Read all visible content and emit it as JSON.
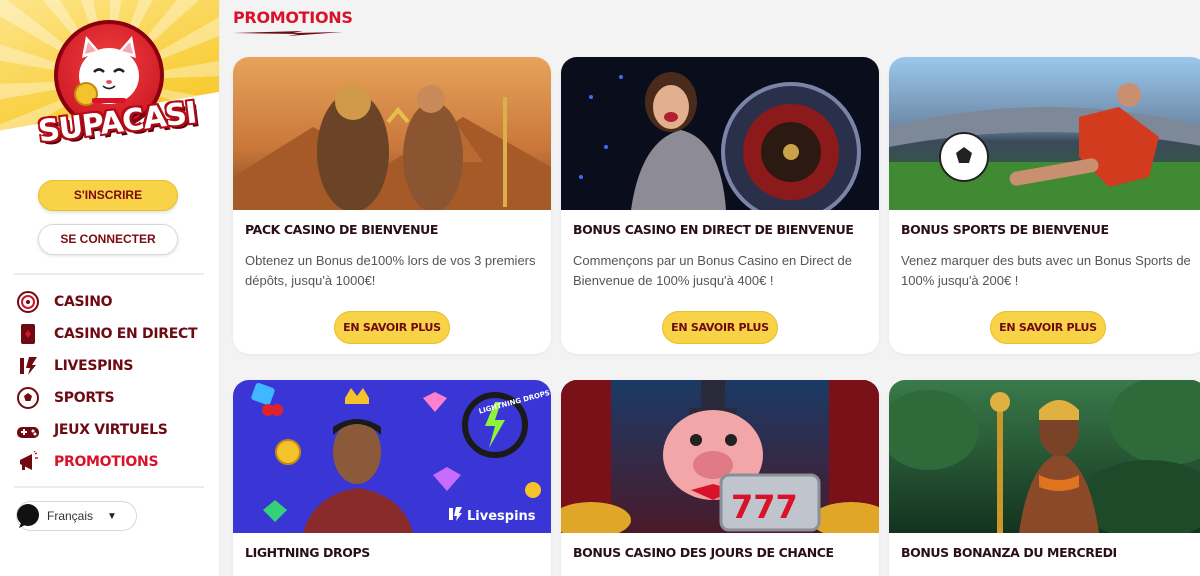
{
  "brand": {
    "name": "SUPACASI"
  },
  "sidebar": {
    "signup_label": "S'INSCRIRE",
    "login_label": "SE CONNECTER",
    "items": [
      {
        "label": "CASINO",
        "icon": "roulette-icon",
        "active": false
      },
      {
        "label": "CASINO EN DIRECT",
        "icon": "card-icon",
        "active": false
      },
      {
        "label": "LIVESPINS",
        "icon": "livespins-icon",
        "active": false
      },
      {
        "label": "SPORTS",
        "icon": "soccer-ball-icon",
        "active": false
      },
      {
        "label": "JEUX VIRTUELS",
        "icon": "gamepad-icon",
        "active": false
      },
      {
        "label": "PROMOTIONS",
        "icon": "megaphone-icon",
        "active": true
      }
    ],
    "language": {
      "label": "Français",
      "icon": "chat-bubble-icon"
    }
  },
  "main": {
    "title": "PROMOTIONS",
    "cards": [
      {
        "title": "PACK CASINO DE BIENVENUE",
        "description": "Obtenez un Bonus de100% lors de vos 3 premiers dépôts, jusqu'à 1000€!",
        "button": "EN SAVOIR PLUS"
      },
      {
        "title": "BONUS CASINO EN DIRECT DE BIENVENUE",
        "description": "Commençons par un Bonus Casino en Direct de Bienvenue de 100% jusqu'à 400€ !",
        "button": "EN SAVOIR PLUS"
      },
      {
        "title": "BONUS SPORTS DE BIENVENUE",
        "description": "Venez marquer des buts avec un Bonus Sports de 100% jusqu'à 200€ !",
        "button": "EN SAVOIR PLUS"
      },
      {
        "title": "LIGHTNING DROPS",
        "image_text": "Livespins",
        "badge_text": "LIGHTNING DROPS"
      },
      {
        "title": "BONUS CASINO DES JOURS DE CHANCE"
      },
      {
        "title": "BONUS BONANZA DU MERCREDI"
      }
    ]
  },
  "colors": {
    "accent_red": "#d9122a",
    "brand_yellow": "#f8d348",
    "dark_maroon": "#6e0a12"
  }
}
